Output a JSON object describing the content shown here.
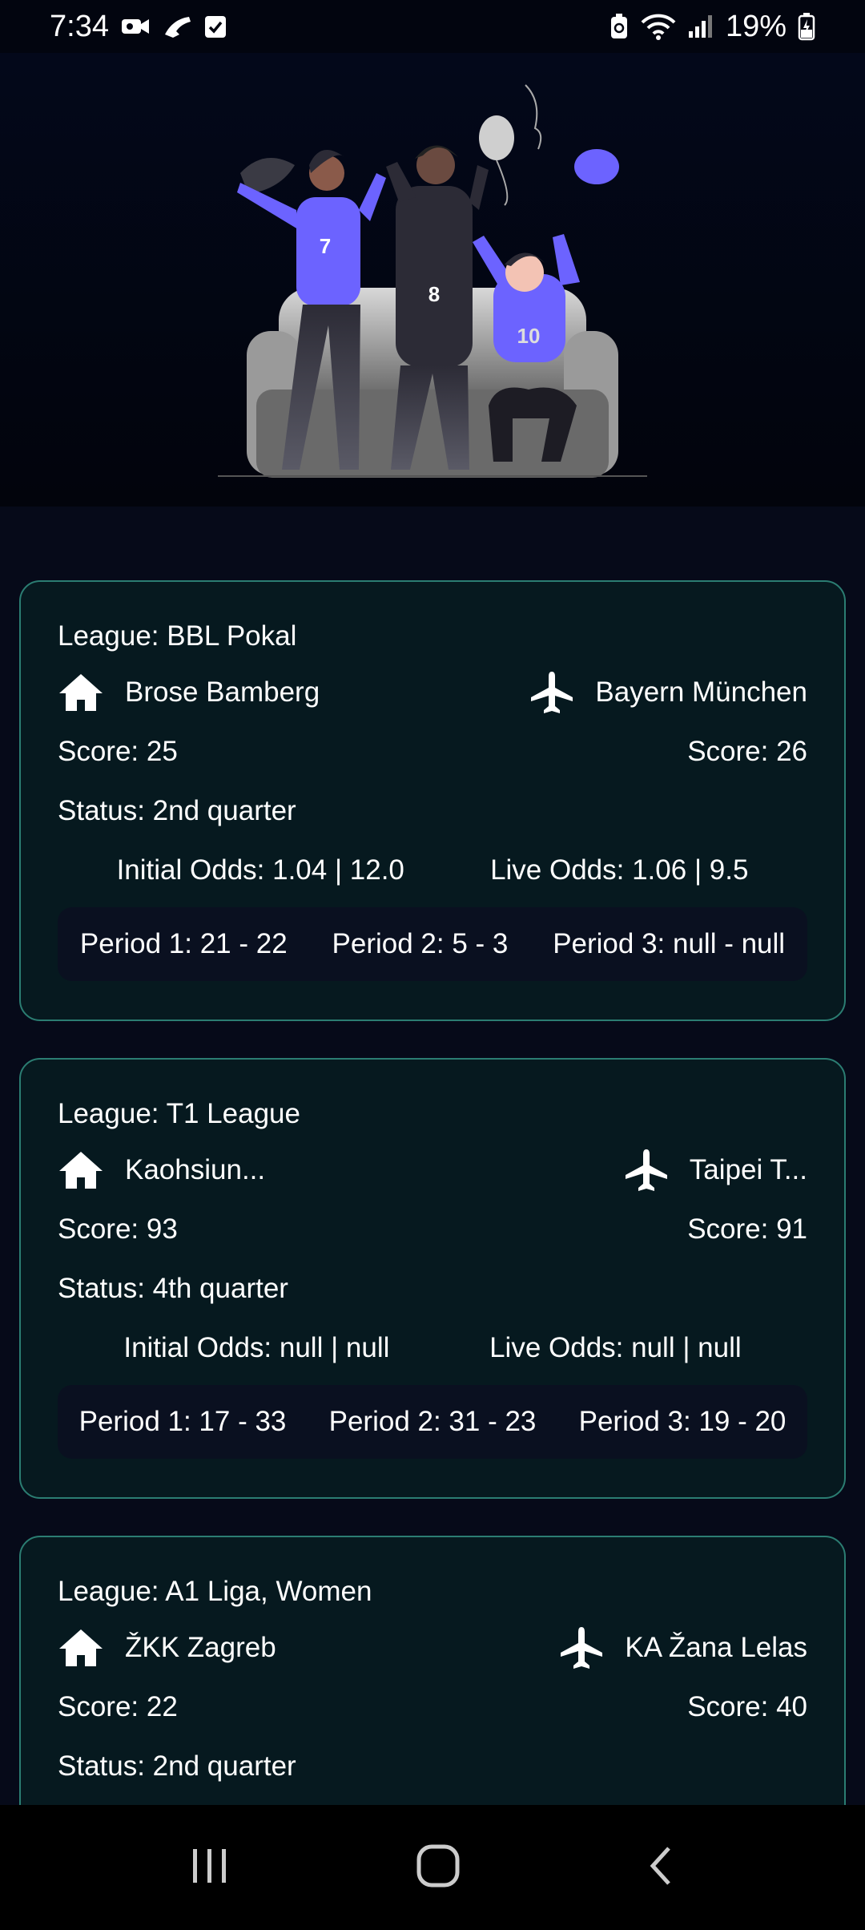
{
  "status_bar": {
    "time": "7:34",
    "battery": "19%",
    "icons_left": [
      "video-camera-icon",
      "phone-call-icon",
      "checkbox-icon"
    ],
    "icons_right": [
      "battery-saver-icon",
      "wifi-icon",
      "signal-icon",
      "battery-charging-icon"
    ]
  },
  "hero": {
    "illustration": "three-fans-celebrating-on-couch",
    "jersey_numbers": [
      "7",
      "8",
      "10"
    ],
    "accent_color": "#6c63ff"
  },
  "matches": [
    {
      "league": "League: BBL Pokal",
      "home_team": "Brose Bamberg",
      "away_team": "Bayern München",
      "home_score": "Score: 25",
      "away_score": "Score: 26",
      "status": "Status: 2nd quarter",
      "initial_odds": "Initial Odds: 1.04 | 12.0",
      "live_odds": "Live Odds: 1.06 | 9.5",
      "periods": [
        "Period 1: 21 - 22",
        "Period 2: 5 - 3",
        "Period 3: null - null"
      ]
    },
    {
      "league": "League: T1 League",
      "home_team": "Kaohsiun...",
      "away_team": "Taipei T...",
      "home_score": "Score: 93",
      "away_score": "Score: 91",
      "status": "Status: 4th quarter",
      "initial_odds": "Initial Odds: null | null",
      "live_odds": "Live Odds: null | null",
      "periods": [
        "Period 1: 17 - 33",
        "Period 2: 31 - 23",
        "Period 3: 19 - 20"
      ]
    },
    {
      "league": "League: A1 Liga, Women",
      "home_team": "ŽKK Zagreb",
      "away_team": "KA Žana Lelas",
      "home_score": "Score: 22",
      "away_score": "Score: 40",
      "status": "Status: 2nd quarter"
    }
  ],
  "icons": {
    "home": "home-icon",
    "away": "airplane-icon"
  },
  "colors": {
    "card_border": "#2b7d72",
    "card_bg": "#06191f",
    "background": "#060a19"
  }
}
